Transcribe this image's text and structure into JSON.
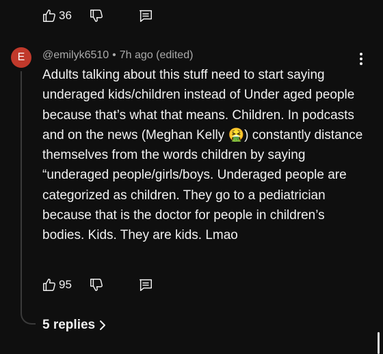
{
  "previous_comment": {
    "like_count": "36",
    "like_icon": "thumbs-up-outline",
    "dislike_icon": "thumbs-down-outline",
    "reply_icon": "comment-outline"
  },
  "comment": {
    "avatar_letter": "E",
    "avatar_color": "#c0392b",
    "handle": "@emilyk6510",
    "separator": "•",
    "timestamp": "7h ago (edited)",
    "text": "Adults talking about this stuff need to start saying underaged kids/children instead of Under aged people because that’s what that means. Children. In podcasts and on the news (Meghan Kelly 🤮) constantly distance themselves from the words children by saying “underaged people/girls/boys. Underaged people are categorized as children. They go to a pediatrician because that is the doctor for people in children’s bodies. Kids. They are kids. Lmao",
    "like_count": "95",
    "more_icon": "vertical-ellipsis"
  },
  "replies": {
    "label": "5 replies",
    "chevron_icon": "chevron-right"
  },
  "colors": {
    "background": "#0f0f0f",
    "text": "#f1f1f1",
    "meta": "#aaaaaa",
    "thread_line": "#3a3a3a"
  }
}
